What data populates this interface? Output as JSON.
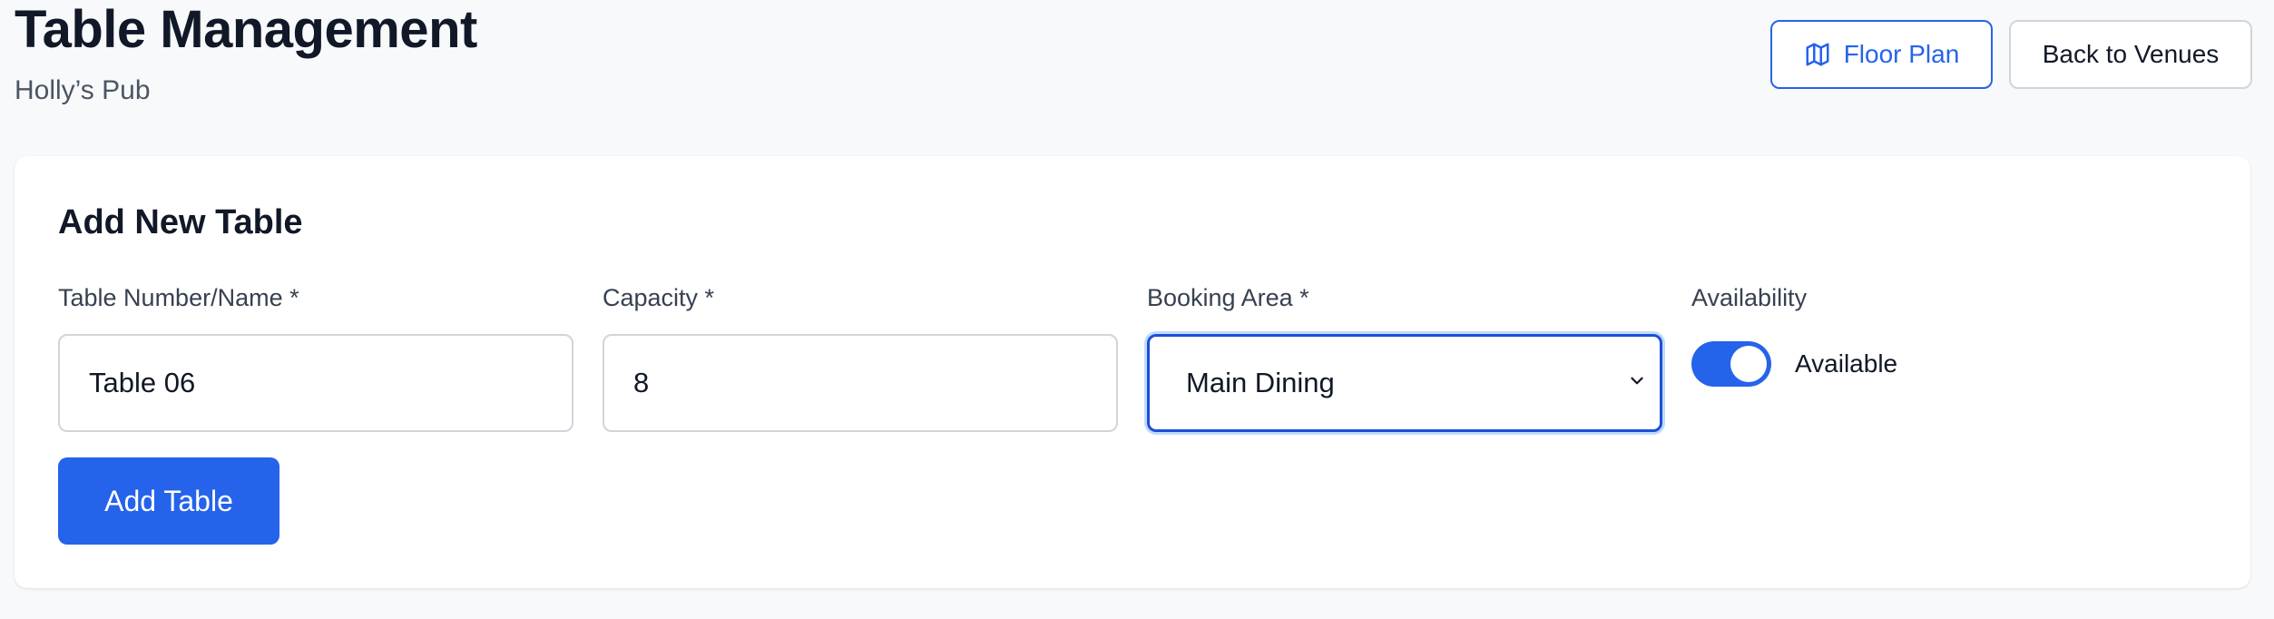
{
  "header": {
    "title": "Table Management",
    "subtitle": "Holly’s Pub",
    "floor_plan_label": "Floor Plan",
    "floor_plan_icon": "map-icon",
    "back_label": "Back to Venues"
  },
  "form": {
    "title": "Add New Table",
    "table_name": {
      "label": "Table Number/Name *",
      "value": "Table 06"
    },
    "capacity": {
      "label": "Capacity *",
      "value": "8"
    },
    "booking_area": {
      "label": "Booking Area *",
      "selected": "Main Dining"
    },
    "availability": {
      "label": "Availability",
      "state_label": "Available",
      "enabled": true
    },
    "submit_label": "Add Table"
  },
  "colors": {
    "accent": "#2563eb",
    "background": "#f8f9fb",
    "card": "#ffffff"
  }
}
